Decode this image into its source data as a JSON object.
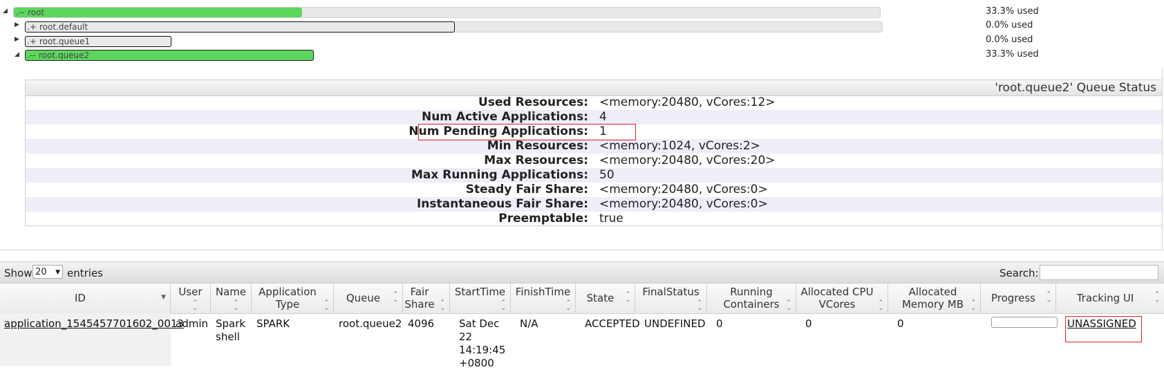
{
  "queues": [
    {
      "name": "root",
      "symbol": ".--",
      "used_label": "33.3% used",
      "fill_fraction": 0.333,
      "expanded": true,
      "selected": false
    },
    {
      "name": "root.default",
      "symbol": ".+",
      "used_label": "0.0% used",
      "fill_fraction": 0.0,
      "expanded": false,
      "selected": true
    },
    {
      "name": "root.queue1",
      "symbol": ".+",
      "used_label": "0.0% used",
      "fill_fraction": 0.0,
      "expanded": false,
      "selected": true
    },
    {
      "name": "root.queue2",
      "symbol": ".--",
      "used_label": "33.3% used",
      "fill_fraction": 0.333,
      "expanded": true,
      "selected": true
    }
  ],
  "queue_status": {
    "title": "'root.queue2' Queue Status",
    "rows": [
      {
        "key": "Used Resources:",
        "value": "<memory:20480, vCores:12>"
      },
      {
        "key": "Num Active Applications:",
        "value": "4"
      },
      {
        "key": "Num Pending Applications:",
        "value": "1"
      },
      {
        "key": "Min Resources:",
        "value": "<memory:1024, vCores:2>"
      },
      {
        "key": "Max Resources:",
        "value": "<memory:20480, vCores:20>"
      },
      {
        "key": "Max Running Applications:",
        "value": "50"
      },
      {
        "key": "Steady Fair Share:",
        "value": "<memory:20480, vCores:0>"
      },
      {
        "key": "Instantaneous Fair Share:",
        "value": "<memory:20480, vCores:0>"
      },
      {
        "key": "Preemptable:",
        "value": "true"
      }
    ]
  },
  "table": {
    "show_label": "Show",
    "entries_label": "entries",
    "page_length": "20",
    "search_label": "Search:",
    "search_value": "",
    "columns": [
      "ID",
      "User",
      "Name",
      "Application Type",
      "Queue",
      "Fair Share",
      "StartTime",
      "FinishTime",
      "State",
      "FinalStatus",
      "Running Containers",
      "Allocated CPU VCores",
      "Allocated Memory MB",
      "Progress",
      "Tracking UI"
    ],
    "rows": [
      {
        "id": "application_1545457701602_0013",
        "user": "admin",
        "name": "Spark shell",
        "app_type": "SPARK",
        "queue": "root.queue2",
        "fair_share": "4096",
        "start_time": "Sat Dec 22 14:19:45 +0800",
        "finish_time": "N/A",
        "state": "ACCEPTED",
        "final_status": "UNDEFINED",
        "running_containers": "0",
        "allocated_vcores": "0",
        "allocated_memory": "0",
        "progress": 0,
        "tracking_ui": "UNASSIGNED"
      }
    ]
  },
  "colors": {
    "bar_fill": "#5cd65c",
    "highlight_box": "#e02020",
    "alt_row": "#eeeef9"
  }
}
